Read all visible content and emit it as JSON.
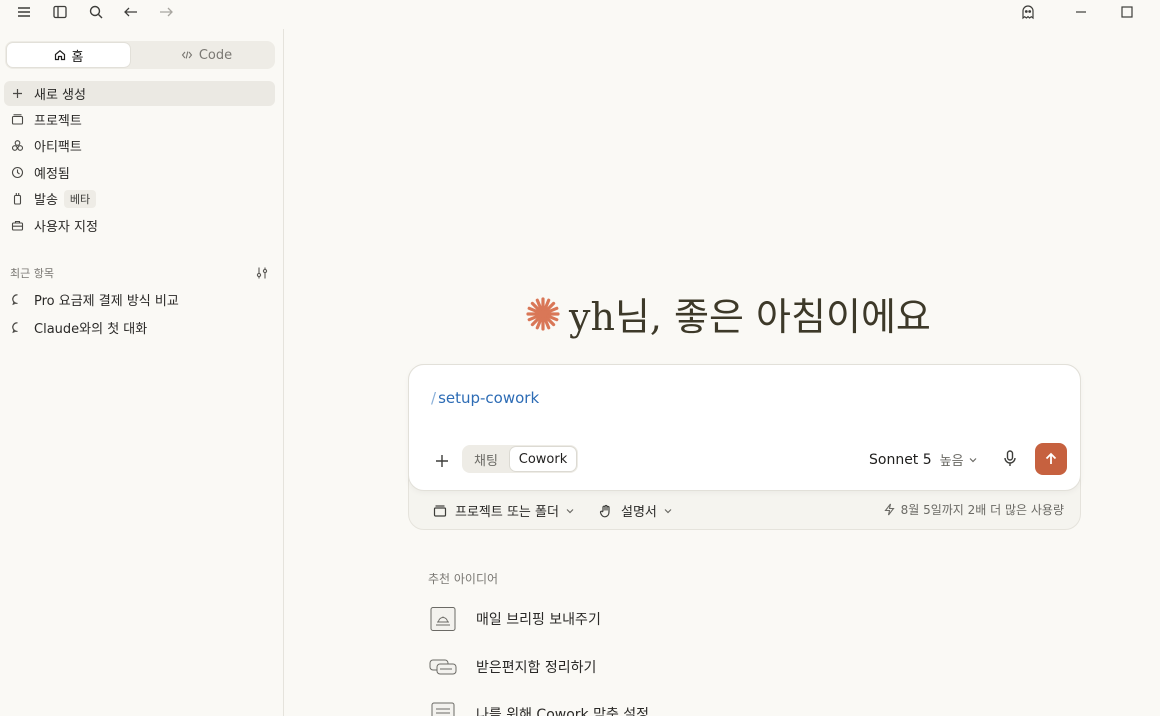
{
  "titlebar": {
    "icons": [
      "menu-icon",
      "sidebar-toggle-icon",
      "search-icon",
      "back-arrow-icon",
      "forward-arrow-icon",
      "ghost-icon",
      "minimize-icon",
      "maximize-icon"
    ]
  },
  "sidebar": {
    "tabs": [
      {
        "label": "홈",
        "icon": "home-icon"
      },
      {
        "label": "Code",
        "icon": "code-icon"
      }
    ],
    "nav": [
      {
        "label": "새로 생성",
        "icon": "plus-icon"
      },
      {
        "label": "프로젝트",
        "icon": "folder-icon"
      },
      {
        "label": "아티팩트",
        "icon": "artifact-icon"
      },
      {
        "label": "예정됨",
        "icon": "clock-icon"
      },
      {
        "label": "발송",
        "icon": "send-device-icon",
        "badge": "베타"
      },
      {
        "label": "사용자 지정",
        "icon": "briefcase-icon"
      }
    ],
    "recent": {
      "heading": "최근 항목",
      "items": [
        "Pro 요금제 결제 방식 비교",
        "Claude와의 첫 대화"
      ]
    }
  },
  "main": {
    "greeting": "yh님, 좋은 아침이에요",
    "composer": {
      "slash": "/",
      "command": "setup-cowork",
      "modes": {
        "chat": "채팅",
        "cowork": "Cowork"
      },
      "model": "Sonnet 5",
      "effort": "높음"
    },
    "bottom": {
      "project_chip": "프로젝트 또는 폴더",
      "instructions_chip": "설명서",
      "usage": "8월 5일까지 2배 더 많은 사용량"
    },
    "ideas": {
      "heading": "추천 아이디어",
      "items": [
        "매일 브리핑 보내주기",
        "받은편지함 정리하기",
        "나를 위해 Cowork 맞춤 설정"
      ]
    }
  },
  "colors": {
    "background": "#faf9f5",
    "accent": "#c6613f",
    "command": "#2d6cb5"
  }
}
